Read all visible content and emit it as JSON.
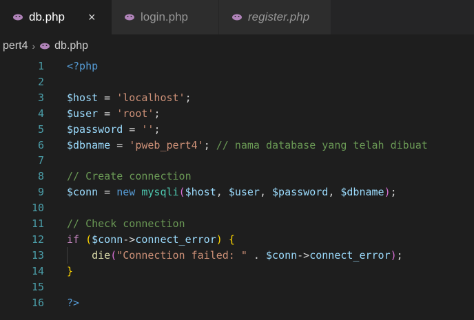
{
  "tabs": [
    {
      "label": "db.php",
      "active": true,
      "italic": false,
      "close": "×"
    },
    {
      "label": "login.php",
      "active": false,
      "italic": false
    },
    {
      "label": "register.php",
      "active": false,
      "italic": true
    }
  ],
  "breadcrumb": {
    "folder": "pert4",
    "separator": "›",
    "file": "db.php"
  },
  "colors": {
    "php_icon": "#b083b9",
    "editor_bg": "#1e1e1e",
    "line_number": "#4b9ea9"
  },
  "lines": [
    {
      "n": "1",
      "tokens": [
        {
          "t": "<?php",
          "c": "tag"
        }
      ]
    },
    {
      "n": "2",
      "tokens": []
    },
    {
      "n": "3",
      "tokens": [
        {
          "t": "$",
          "c": "var"
        },
        {
          "t": "host",
          "c": "var"
        },
        {
          "t": " = ",
          "c": "op"
        },
        {
          "t": "'localhost'",
          "c": "str"
        },
        {
          "t": ";",
          "c": "op"
        }
      ]
    },
    {
      "n": "4",
      "tokens": [
        {
          "t": "$user",
          "c": "var"
        },
        {
          "t": " = ",
          "c": "op"
        },
        {
          "t": "'root'",
          "c": "str"
        },
        {
          "t": ";",
          "c": "op"
        }
      ]
    },
    {
      "n": "5",
      "tokens": [
        {
          "t": "$password",
          "c": "var"
        },
        {
          "t": " = ",
          "c": "op"
        },
        {
          "t": "''",
          "c": "str"
        },
        {
          "t": ";",
          "c": "op"
        }
      ]
    },
    {
      "n": "6",
      "tokens": [
        {
          "t": "$dbname",
          "c": "var"
        },
        {
          "t": " = ",
          "c": "op"
        },
        {
          "t": "'pweb_pert4'",
          "c": "str"
        },
        {
          "t": "; ",
          "c": "op"
        },
        {
          "t": "// nama database yang telah dibuat",
          "c": "cmt"
        }
      ]
    },
    {
      "n": "7",
      "tokens": []
    },
    {
      "n": "8",
      "tokens": [
        {
          "t": "// Create connection",
          "c": "cmt"
        }
      ]
    },
    {
      "n": "9",
      "tokens": [
        {
          "t": "$conn",
          "c": "var"
        },
        {
          "t": " = ",
          "c": "op"
        },
        {
          "t": "new",
          "c": "new"
        },
        {
          "t": " ",
          "c": "op"
        },
        {
          "t": "mysqli",
          "c": "cls"
        },
        {
          "t": "(",
          "c": "paren"
        },
        {
          "t": "$host",
          "c": "var"
        },
        {
          "t": ", ",
          "c": "op"
        },
        {
          "t": "$user",
          "c": "var"
        },
        {
          "t": ", ",
          "c": "op"
        },
        {
          "t": "$password",
          "c": "var"
        },
        {
          "t": ", ",
          "c": "op"
        },
        {
          "t": "$dbname",
          "c": "var"
        },
        {
          "t": ")",
          "c": "paren"
        },
        {
          "t": ";",
          "c": "op"
        }
      ]
    },
    {
      "n": "10",
      "tokens": []
    },
    {
      "n": "11",
      "tokens": [
        {
          "t": "// Check connection",
          "c": "cmt"
        }
      ]
    },
    {
      "n": "12",
      "tokens": [
        {
          "t": "if",
          "c": "kw"
        },
        {
          "t": " ",
          "c": "op"
        },
        {
          "t": "(",
          "c": "brace"
        },
        {
          "t": "$conn",
          "c": "var"
        },
        {
          "t": "->",
          "c": "op"
        },
        {
          "t": "connect_error",
          "c": "var"
        },
        {
          "t": ")",
          "c": "brace"
        },
        {
          "t": " ",
          "c": "op"
        },
        {
          "t": "{",
          "c": "brace"
        }
      ]
    },
    {
      "n": "13",
      "tokens": [
        {
          "t": "    ",
          "c": "op"
        },
        {
          "t": "die",
          "c": "fn"
        },
        {
          "t": "(",
          "c": "paren"
        },
        {
          "t": "\"Connection failed: \"",
          "c": "str"
        },
        {
          "t": " . ",
          "c": "op"
        },
        {
          "t": "$conn",
          "c": "var"
        },
        {
          "t": "->",
          "c": "op"
        },
        {
          "t": "connect_error",
          "c": "var"
        },
        {
          "t": ")",
          "c": "paren"
        },
        {
          "t": ";",
          "c": "op"
        }
      ]
    },
    {
      "n": "14",
      "tokens": [
        {
          "t": "}",
          "c": "brace"
        }
      ]
    },
    {
      "n": "15",
      "tokens": []
    },
    {
      "n": "16",
      "tokens": [
        {
          "t": "?>",
          "c": "tag"
        }
      ]
    }
  ]
}
